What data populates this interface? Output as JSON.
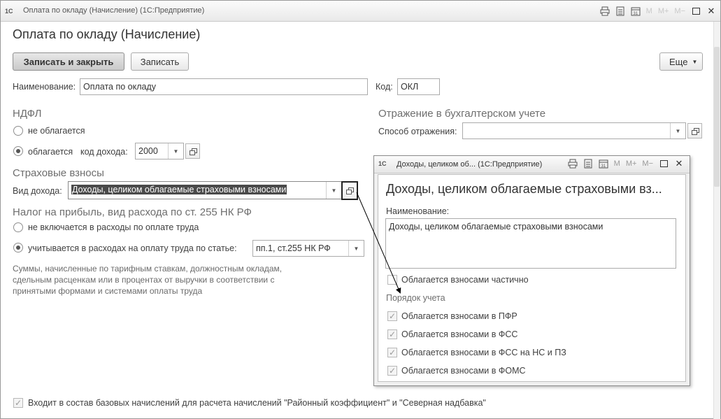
{
  "window": {
    "title": "Оплата по окладу (Начисление)  (1С:Предприятие)",
    "logo": "1С",
    "tb_m": "M",
    "tb_mplus": "M+",
    "tb_mminus": "M−"
  },
  "form": {
    "header": "Оплата по окладу (Начисление)",
    "save_close": "Записать и закрыть",
    "save": "Записать",
    "more": "Еще",
    "name_label": "Наименование:",
    "name_value": "Оплата по окладу",
    "code_label": "Код:",
    "code_value": "ОКЛ"
  },
  "ndfl": {
    "title": "НДФЛ",
    "option1": "не облагается",
    "option2": "облагается",
    "income_code_label": "код дохода:",
    "income_code_value": "2000"
  },
  "accounting": {
    "title": "Отражение в бухгалтерском учете",
    "method_label": "Способ отражения:",
    "method_value": ""
  },
  "insurance": {
    "title": "Страховые взносы",
    "income_type_label": "Вид дохода:",
    "income_type_value": "Доходы, целиком облагаемые страховыми взносами"
  },
  "profit_tax": {
    "title": "Налог на прибыль, вид расхода по ст. 255 НК РФ",
    "option1": "не включается в расходы по оплате труда",
    "option2": "учитывается в расходах на оплату труда по статье:",
    "article_value": "пп.1, ст.255 НК РФ",
    "note": "Суммы, начисленные по тарифным ставкам, должностным окладам, сдельным расценкам или в процентах от выручки в соответствии с принятыми формами и системами оплаты труда"
  },
  "footer": {
    "checkbox_label": "Входит в состав базовых начислений для расчета начислений \"Районный коэффициент\" и \"Северная надбавка\"",
    "checked": true
  },
  "popup": {
    "title": "Доходы, целиком об...  (1С:Предприятие)",
    "header": "Доходы, целиком облагаемые страховыми вз...",
    "name_label": "Наименование:",
    "name_value": "Доходы, целиком облагаемые страховыми взносами",
    "partial_label": "Облагается взносами частично",
    "partial_checked": false,
    "order_label": "Порядок учета",
    "checks": [
      {
        "label": "Облагается взносами в ПФР",
        "checked": true
      },
      {
        "label": "Облагается взносами в ФСС",
        "checked": true
      },
      {
        "label": "Облагается взносами в ФСС на НС и ПЗ",
        "checked": true
      },
      {
        "label": "Облагается взносами в ФОМС",
        "checked": true
      }
    ]
  }
}
